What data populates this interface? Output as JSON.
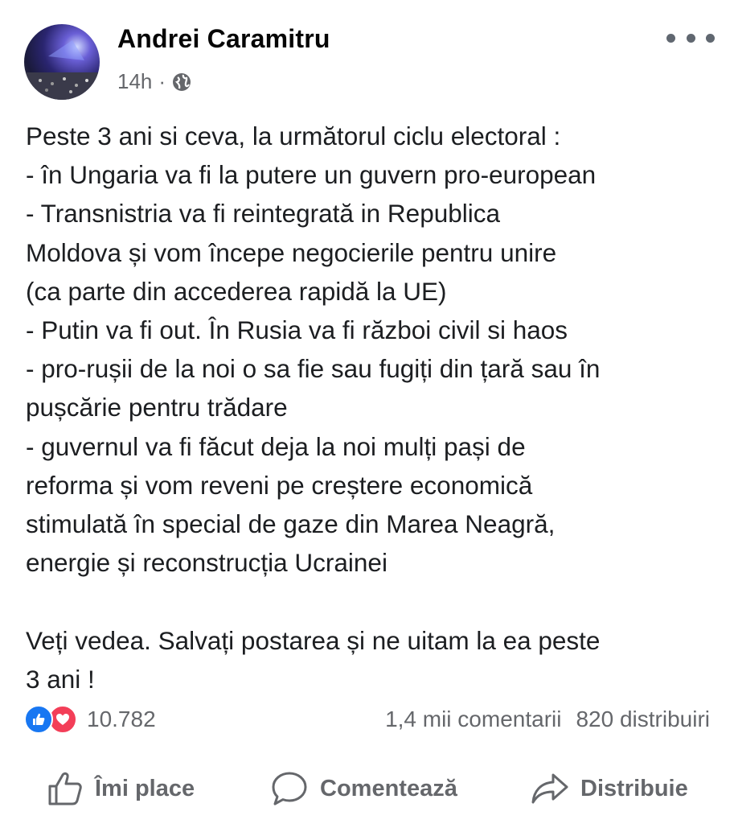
{
  "post": {
    "author": "Andrei Caramitru",
    "time": "14h",
    "separator": "·",
    "privacy_icon": "globe-icon",
    "lines": [
      "Peste 3 ani si ceva, la următorul ciclu electoral :",
      "- în Ungaria va fi la putere un guvern pro-european",
      "- Transnistria va fi reintegrată in Republica",
      "Moldova și vom începe negocierile pentru unire",
      "(ca parte din accederea rapidă la UE)",
      "- Putin va fi out. În Rusia va fi război civil si haos",
      "- pro-rușii de la noi o sa fie sau fugiți din țară sau în",
      "pușcărie pentru trădare",
      "- guvernul va fi făcut deja la noi mulți pași de",
      "reforma și vom reveni pe creștere economică",
      "stimulată în special de gaze din Marea Neagră,",
      "energie și reconstrucția Ucrainei"
    ],
    "closing_lines": [
      "Veți vedea. Salvați postarea și ne uitam la ea peste",
      "3 ani !"
    ]
  },
  "stats": {
    "reaction_count": "10.782",
    "comments": "1,4 mii comentarii",
    "shares": "820 distribuiri"
  },
  "actions": {
    "like_label": "Îmi place",
    "comment_label": "Comentează",
    "share_label": "Distribuie"
  },
  "colors": {
    "like_blue": "#1877f2",
    "love_red": "#f33e58",
    "secondary_text": "#65676b"
  }
}
